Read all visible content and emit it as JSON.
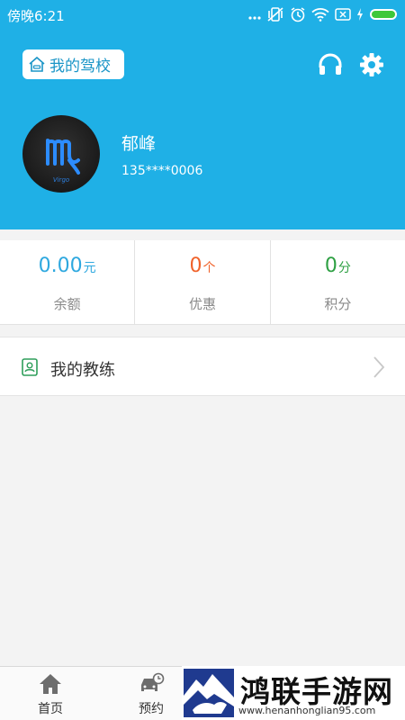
{
  "status_bar": {
    "time": "傍晚6:21",
    "icons": [
      "more-dots-icon",
      "vibrate-off-icon",
      "alarm-icon",
      "wifi-icon",
      "sim-off-icon",
      "charging-icon",
      "battery-icon"
    ]
  },
  "header": {
    "school_button_label": "我的驾校",
    "school_icon": "home-car-icon",
    "support_icon": "headphones-icon",
    "settings_icon": "gear-icon",
    "background_color": "#1fb0e6"
  },
  "user": {
    "name": "郁峰",
    "phone": "135****0006",
    "avatar_text": "Virgo"
  },
  "stats": [
    {
      "value": "0.00",
      "unit": "元",
      "label": "余额",
      "color": "#2ea8df"
    },
    {
      "value": "0",
      "unit": "个",
      "label": "优惠",
      "color": "#f0622a"
    },
    {
      "value": "0",
      "unit": "分",
      "label": "积分",
      "color": "#2ea043"
    }
  ],
  "menu": {
    "my_coach_label": "我的教练",
    "my_coach_icon": "contact-card-icon"
  },
  "tabbar": {
    "tabs": [
      {
        "label": "首页",
        "icon": "home-icon"
      },
      {
        "label": "预约",
        "icon": "car-clock-icon"
      }
    ]
  },
  "watermark": {
    "title": "鸿联手游网",
    "url": "www.henanhonglian95.com"
  }
}
